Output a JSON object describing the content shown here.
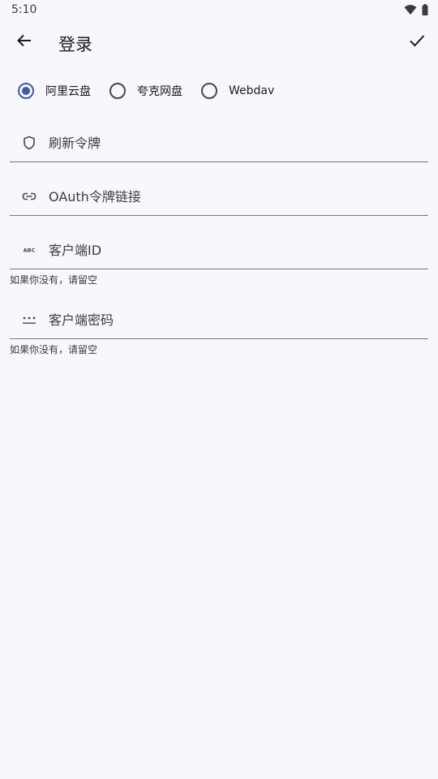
{
  "status_bar": {
    "time": "5:10",
    "icons": [
      "wifi-icon",
      "battery-icon"
    ]
  },
  "app_bar": {
    "back_icon": "arrow-back-icon",
    "title": "登录",
    "confirm_icon": "check-icon"
  },
  "provider_options": [
    {
      "label": "阿里云盘",
      "selected": true
    },
    {
      "label": "夸克网盘",
      "selected": false
    },
    {
      "label": "Webdav",
      "selected": false
    }
  ],
  "fields": {
    "refresh_token": {
      "icon": "shield-icon",
      "placeholder": "刷新令牌",
      "value": ""
    },
    "oauth_link": {
      "icon": "link-icon",
      "placeholder": "OAuth令牌链接",
      "value": ""
    },
    "client_id": {
      "icon": "abc-icon",
      "placeholder": "客户端ID",
      "value": "",
      "helper": "如果你没有，请留空"
    },
    "client_secret": {
      "icon": "password-icon",
      "placeholder": "客户端密码",
      "value": "",
      "helper": "如果你没有，请留空"
    }
  },
  "colors": {
    "background": "#f8f7fc",
    "accent": "#3f5aa9",
    "outline": "#77767d"
  }
}
